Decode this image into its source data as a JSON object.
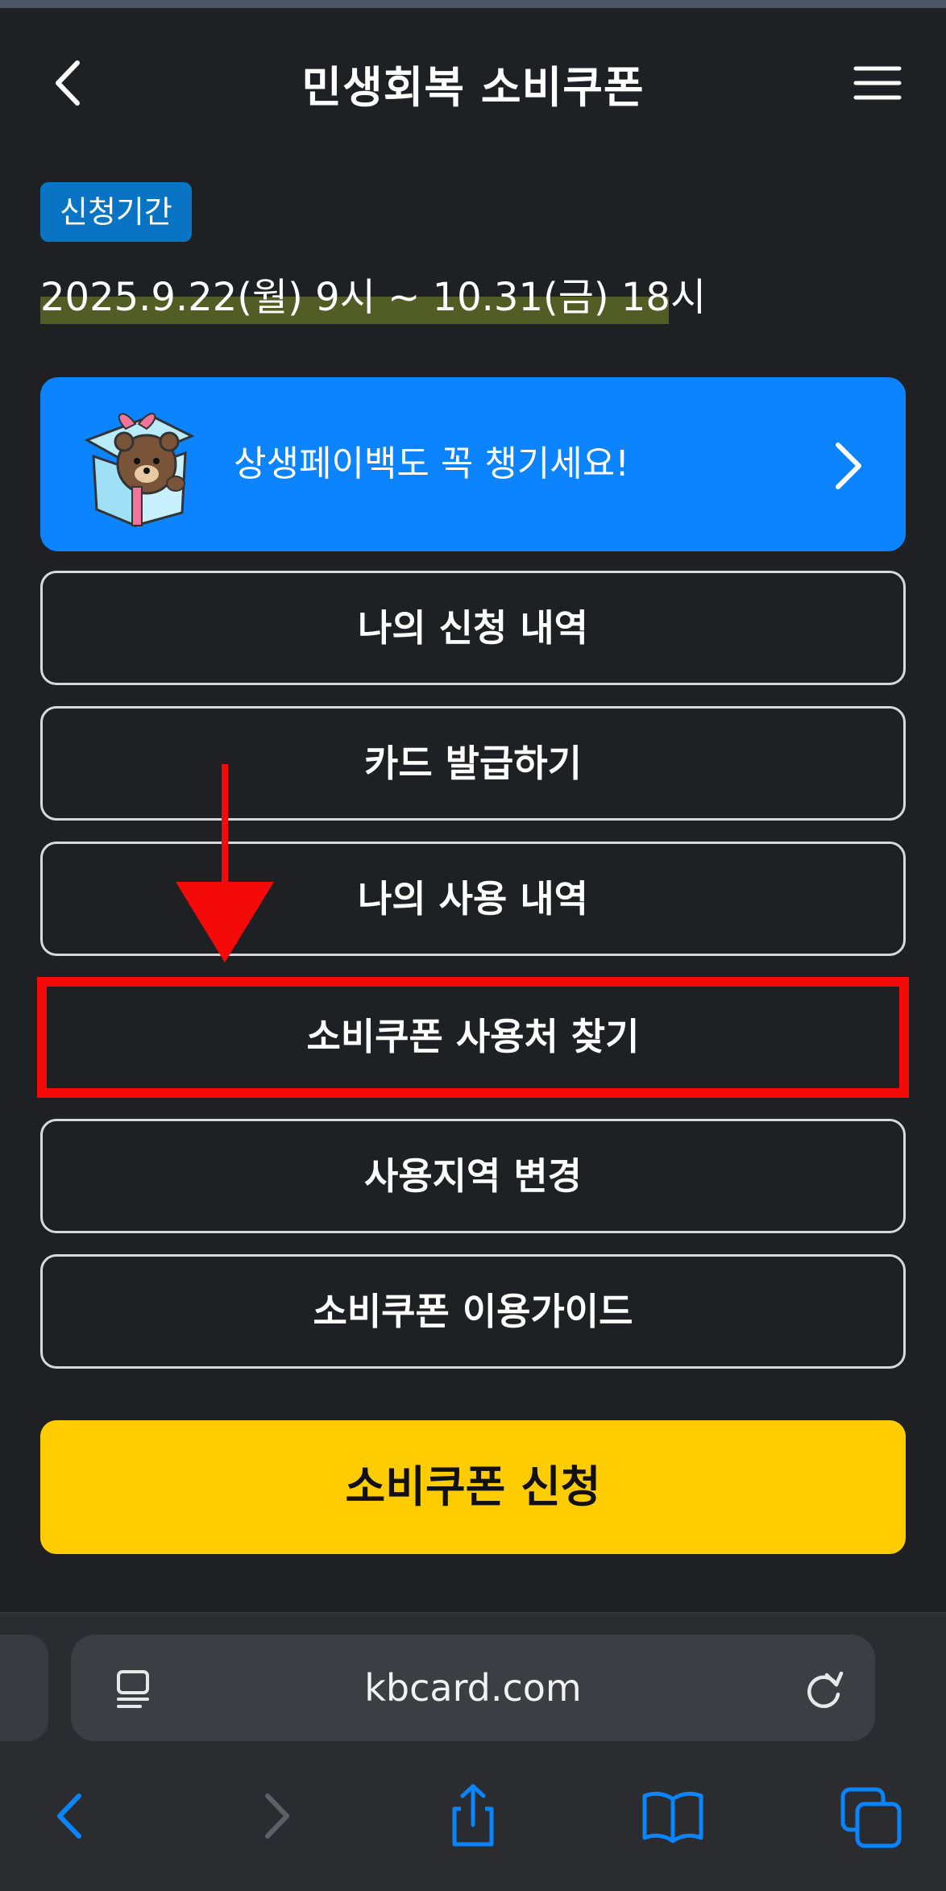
{
  "header": {
    "title": "민생회복 소비쿠폰",
    "back_icon": "chevron-left-icon",
    "menu_icon": "hamburger-menu-icon"
  },
  "period": {
    "badge": "신청기간",
    "text": "2025.9.22(월) 9시 ~ 10.31(금) 18시"
  },
  "banner": {
    "text": "상생페이백도 꼭 챙기세요!",
    "mascot_icon": "bear-gift-box-icon",
    "chevron_icon": "chevron-right-icon"
  },
  "menu": {
    "items": [
      {
        "label": "나의 신청 내역"
      },
      {
        "label": "카드 발급하기"
      },
      {
        "label": "나의 사용 내역"
      },
      {
        "label": "소비쿠폰 사용처 찾기"
      },
      {
        "label": "사용지역 변경"
      },
      {
        "label": "소비쿠폰 이용가이드"
      }
    ]
  },
  "apply_button": {
    "label": "소비쿠폰 신청"
  },
  "browser": {
    "url": "kbcard.com",
    "reader_icon": "reader-icon",
    "reload_icon": "reload-icon",
    "toolbar": [
      "back-icon",
      "forward-icon",
      "share-icon",
      "bookmarks-icon",
      "tabs-icon"
    ]
  },
  "colors": {
    "background": "#1f2024",
    "badge": "#0a74c4",
    "banner": "#0c84ff",
    "highlight_border": "#f50a0a",
    "apply": "#ffcc00",
    "ios_blue": "#0a84ff"
  }
}
